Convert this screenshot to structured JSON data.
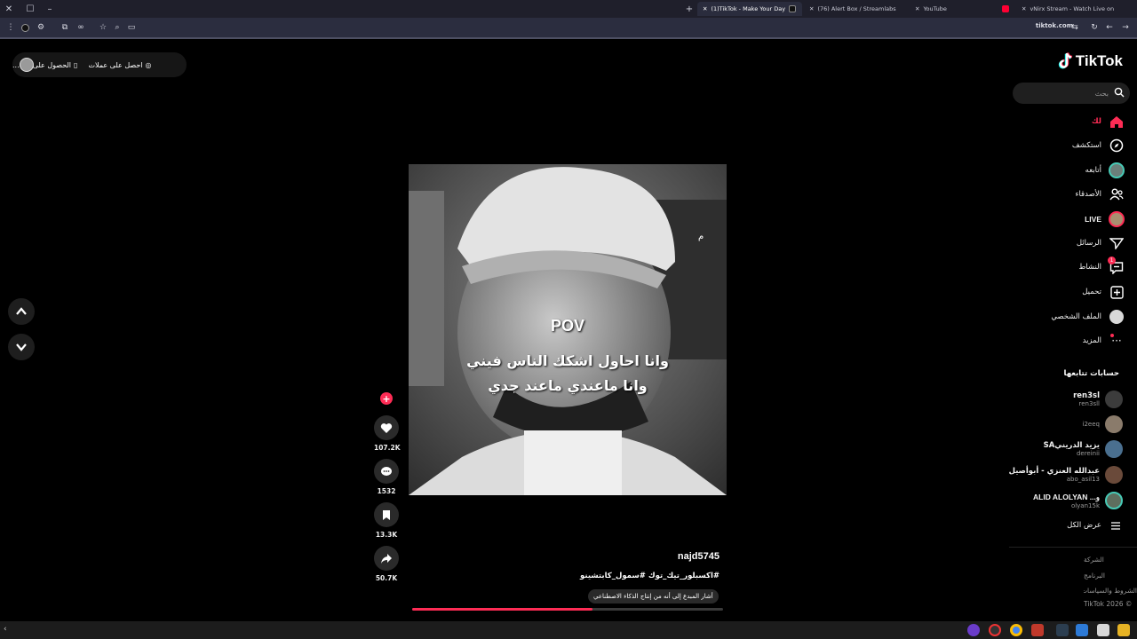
{
  "browser": {
    "tabs": [
      {
        "label": "(1)TikTok - Make Your Day",
        "active": true
      },
      {
        "label": "(76) Alert Box / Streamlabs",
        "active": false
      },
      {
        "label": "YouTube",
        "active": false
      },
      {
        "label": "vNirx Stream - Watch Live on K",
        "active": false
      }
    ],
    "new_tab": "+",
    "address": "tiktok.com"
  },
  "banner": {
    "item1": "احصل على عملات",
    "item2": "الحصول على الت..."
  },
  "video": {
    "pov": "POV",
    "line1": "وانا احاول اشكك الناس فيني",
    "line2": "وانا ماعندي ماعند جدي",
    "corner_mark": "م",
    "author": "najd5745",
    "hashtags": "#اكسبلور_تيك_توك #سمول_كابتشينو",
    "ai_label": "أشار المبدع إلى أنه من إنتاج الذكاء الاصطناعي",
    "progress": 0.58
  },
  "actions": {
    "likes": "107.2K",
    "comments": "1532",
    "saves": "13.3K",
    "shares": "50.7K"
  },
  "sidebar": {
    "logo": "TikTok",
    "search_placeholder": "بحث",
    "items": [
      {
        "label": "لك",
        "icon": "home-icon"
      },
      {
        "label": "استكشف",
        "icon": "compass-icon"
      },
      {
        "label": "أتابعه",
        "icon": "avatar-icon"
      },
      {
        "label": "الأصدقاء",
        "icon": "friends-icon"
      },
      {
        "label": "LIVE",
        "icon": "live-icon"
      },
      {
        "label": "الرسائل",
        "icon": "send-icon"
      },
      {
        "label": "النشاط",
        "icon": "activity-icon"
      },
      {
        "label": "تحميل",
        "icon": "upload-icon"
      },
      {
        "label": "الملف الشخصي",
        "icon": "profile-icon"
      },
      {
        "label": "المزيد",
        "icon": "more-icon"
      }
    ],
    "activity_badge": "1",
    "following_title": "حسابات تتابعها",
    "accounts": [
      {
        "name": "ren3sl",
        "user": "ren3sll"
      },
      {
        "name": "",
        "user": "i2eeq"
      },
      {
        "name": "يزيد الدرينيSA",
        "user": "dereinii"
      },
      {
        "name": "عبدالله العنزي - أبوأصيل",
        "user": "abo_asil13"
      },
      {
        "name": "ALID ALOLYAN ...ﻭ",
        "user": "olyan15k"
      }
    ],
    "see_all": "عرض الكل",
    "footer": [
      "الشركة",
      "البرنامج",
      "الشروط والسياسات",
      "TikTok 2026 ©"
    ]
  },
  "colors": {
    "accent": "#fe2c55",
    "teal": "#25f4ee"
  }
}
